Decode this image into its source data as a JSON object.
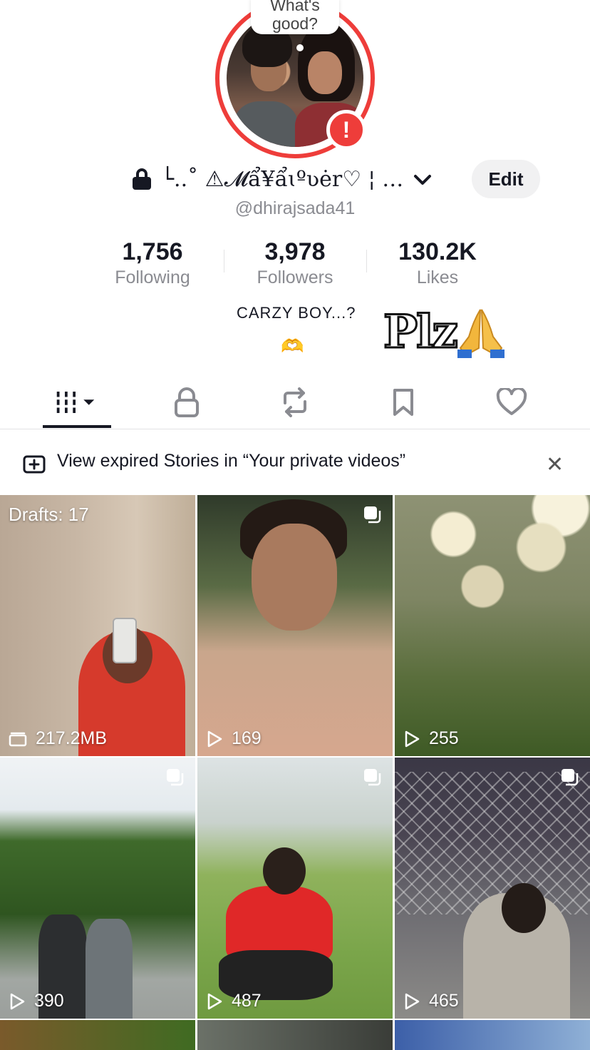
{
  "profile": {
    "bubble_text": "What's good?",
    "alert_badge": "!",
    "display_name": "└..˚ ⚠𝓜ẩ¥ẩɩºʋėr♡ ¦ …",
    "edit_label": "Edit",
    "username": "@dhirajsada41"
  },
  "stats": {
    "following_count": "1,756",
    "following_label": "Following",
    "followers_count": "3,978",
    "followers_label": "Followers",
    "likes_count": "130.2K",
    "likes_label": "Likes"
  },
  "bio": {
    "text": "CARZY BOY...?",
    "emoji": "🫶",
    "sticker_text": "Plz"
  },
  "tabs": [
    {
      "name": "videos-grid",
      "icon": "grid-bars-icon",
      "active": true
    },
    {
      "name": "private",
      "icon": "lock-icon"
    },
    {
      "name": "reposts",
      "icon": "repost-icon"
    },
    {
      "name": "favorites",
      "icon": "bookmark-icon"
    },
    {
      "name": "liked",
      "icon": "heart-icon"
    }
  ],
  "banner": {
    "text": "View expired Stories in “Your private videos”",
    "close": "✕"
  },
  "grid": {
    "drafts_label": "Drafts: 17",
    "drafts_size": "217.2MB",
    "views": [
      "169",
      "255",
      "390",
      "487",
      "465"
    ]
  },
  "colors": {
    "accent_red": "#ee3d3a",
    "text_primary": "#161823",
    "text_secondary": "#8a8b91"
  }
}
